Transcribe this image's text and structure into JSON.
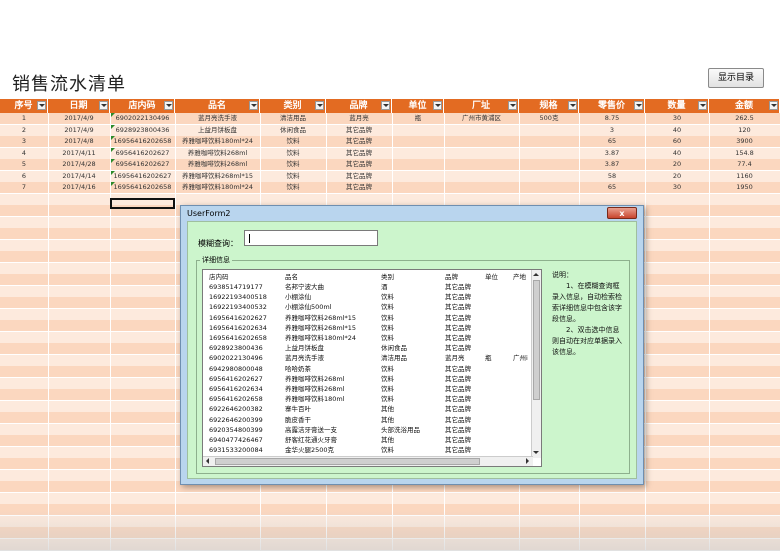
{
  "sheet": {
    "title": "销售流水清单",
    "show_dir_button": "显示目录",
    "columns": [
      "序号",
      "日期",
      "店内码",
      "品名",
      "类别",
      "品牌",
      "单位",
      "厂址",
      "规格",
      "零售价",
      "数量",
      "金额"
    ],
    "rows": [
      [
        "1",
        "2017/4/9",
        "6902022130496",
        "蓝月亮洗手液",
        "清洁用品",
        "蓝月亮",
        "瓶",
        "广州市黄浦区",
        "500克",
        "8.75",
        "30",
        "262.5"
      ],
      [
        "2",
        "2017/4/9",
        "6928923800436",
        "上益月饼板盘",
        "休闲食品",
        "其它品牌",
        "",
        "",
        "",
        "3",
        "40",
        "120"
      ],
      [
        "3",
        "2017/4/8",
        "16956416202658",
        "养雅咖啡饮料180ml*24",
        "饮料",
        "其它品牌",
        "",
        "",
        "",
        "65",
        "60",
        "3900"
      ],
      [
        "4",
        "2017/4/11",
        "6956416202627",
        "养雅咖啡饮料268ml",
        "饮料",
        "其它品牌",
        "",
        "",
        "",
        "3.87",
        "40",
        "154.8"
      ],
      [
        "5",
        "2017/4/28",
        "6956416202627",
        "养雅咖啡饮料268ml",
        "饮料",
        "其它品牌",
        "",
        "",
        "",
        "3.87",
        "20",
        "77.4"
      ],
      [
        "6",
        "2017/4/14",
        "16956416202627",
        "养雅咖啡饮料268ml*15",
        "饮料",
        "其它品牌",
        "",
        "",
        "",
        "58",
        "20",
        "1160"
      ],
      [
        "7",
        "2017/4/16",
        "16956416202658",
        "养雅咖啡饮料180ml*24",
        "饮料",
        "其它品牌",
        "",
        "",
        "",
        "65",
        "30",
        "1950"
      ]
    ]
  },
  "dialog": {
    "title": "UserForm2",
    "close_label": "x",
    "query_label": "模糊查询：",
    "query_value": "",
    "frame_label": "详细信息",
    "list_headers": [
      "店内码",
      "品名",
      "类别",
      "品牌",
      "单位",
      "产地"
    ],
    "list_rows": [
      [
        "6938514719177",
        "名邦宁波大曲",
        "酒",
        "其它品牌",
        "",
        ""
      ],
      [
        "16922193400518",
        "小棚涂仙",
        "饮料",
        "其它品牌",
        "",
        ""
      ],
      [
        "16922193400532",
        "小棚涂仙500ml",
        "饮料",
        "其它品牌",
        "",
        ""
      ],
      [
        "16956416202627",
        "养雅咖啡饮料268ml*15",
        "饮料",
        "其它品牌",
        "",
        ""
      ],
      [
        "16956416202634",
        "养雅咖啡饮料268ml*15",
        "饮料",
        "其它品牌",
        "",
        ""
      ],
      [
        "16956416202658",
        "养雅咖啡饮料180ml*24",
        "饮料",
        "其它品牌",
        "",
        ""
      ],
      [
        "6928923800436",
        "上益月饼板盘",
        "休闲食品",
        "其它品牌",
        "",
        ""
      ],
      [
        "6902022130496",
        "蓝月亮洗手液",
        "清洁用品",
        "蓝月亮",
        "瓶",
        "广州i"
      ],
      [
        "6942980800048",
        "哈哈奶茶",
        "饮料",
        "其它品牌",
        "",
        ""
      ],
      [
        "6956416202627",
        "养雅咖啡饮料268ml",
        "饮料",
        "其它品牌",
        "",
        ""
      ],
      [
        "6956416202634",
        "养雅咖啡饮料268ml",
        "饮料",
        "其它品牌",
        "",
        ""
      ],
      [
        "6956416202658",
        "养雅咖啡饮料180ml",
        "饮料",
        "其它品牌",
        "",
        ""
      ],
      [
        "6922646200382",
        "寨牛百叶",
        "其他",
        "其它品牌",
        "",
        ""
      ],
      [
        "6922646200399",
        "脆皮香干",
        "其他",
        "其它品牌",
        "",
        ""
      ],
      [
        "6920354800399",
        "高露洁牙膏送一支",
        "头部洗浴用品",
        "其它品牌",
        "",
        ""
      ],
      [
        "6940477426467",
        "舒客红花通火牙膏",
        "其他",
        "其它品牌",
        "",
        ""
      ],
      [
        "6931533200084",
        "金华火腿2500克",
        "饮料",
        "其它品牌",
        "",
        ""
      ]
    ],
    "notes": [
      "说明：",
      "1、在模糊查询框录入信息，自动检索检索详细信息中包含该字段信息。",
      "2、双击选中信息则自动在对应单据录入该信息。"
    ]
  }
}
